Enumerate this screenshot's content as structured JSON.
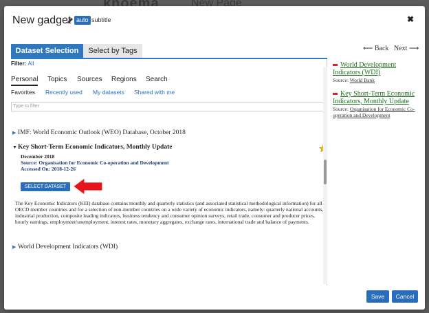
{
  "background": {
    "logo": "knoema",
    "page_title": "New Page"
  },
  "header": {
    "title": "New gadget",
    "auto_badge": "auto",
    "subtitle": "subtitle"
  },
  "tabs": [
    {
      "label": "Dataset Selection",
      "active": true
    },
    {
      "label": "Select by Tags",
      "active": false
    }
  ],
  "nav": {
    "back": "Back",
    "next": "Next"
  },
  "filter": {
    "label": "Filter:",
    "value": "All"
  },
  "subtabs": [
    "Personal",
    "Topics",
    "Sources",
    "Regions",
    "Search"
  ],
  "categories": [
    "Favorites",
    "Recently used",
    "My datasets",
    "Shared with me"
  ],
  "search": {
    "placeholder": "Type to filter"
  },
  "datasets": [
    {
      "label": "IMF: World Economic Outlook (WEO) Database, October 2018",
      "expanded": false
    },
    {
      "label": "Key Short-Term Economic Indicators, Monthly Update",
      "expanded": true
    },
    {
      "label": "World Development Indicators (WDI)",
      "expanded": false
    }
  ],
  "detail": {
    "date": "December 2018",
    "source": "Source: Organisation for Economic Co-operation and Development",
    "accessed": "Accessed On: 2018-12-26",
    "select_label": "SELECT DATASET",
    "description": "The Key Economic Indicators (KEI) database contains monthly and quarterly statistics (and associated statistical methodological information) for all OECD member countries and for a selection of non-member countries on a wide variety of economic indicators, namely: quarterly national accounts, industrial production, composite leading indicators, business tendency and consumer opinion surveys, retail trade, consumer and producer prices, hourly earnings, employment/unemployment, interest rates, monetary aggregates, exchange rates, international trade and balance of payments."
  },
  "selected": [
    {
      "title": "World Development Indicators (WDI)",
      "source_prefix": "Source:",
      "source": "World Bank"
    },
    {
      "title": "Key Short-Term Economic Indicators, Monthly Update",
      "source_prefix": "Source:",
      "source": "Organisation for Economic Co-operation and Development"
    }
  ],
  "footer": {
    "save": "Save",
    "cancel": "Cancel"
  },
  "colors": {
    "primary": "#2f78bf",
    "remove": "#d9202b",
    "link_green": "#1f6e1f",
    "star": "#f0c419",
    "arrow": "#e8141b"
  }
}
